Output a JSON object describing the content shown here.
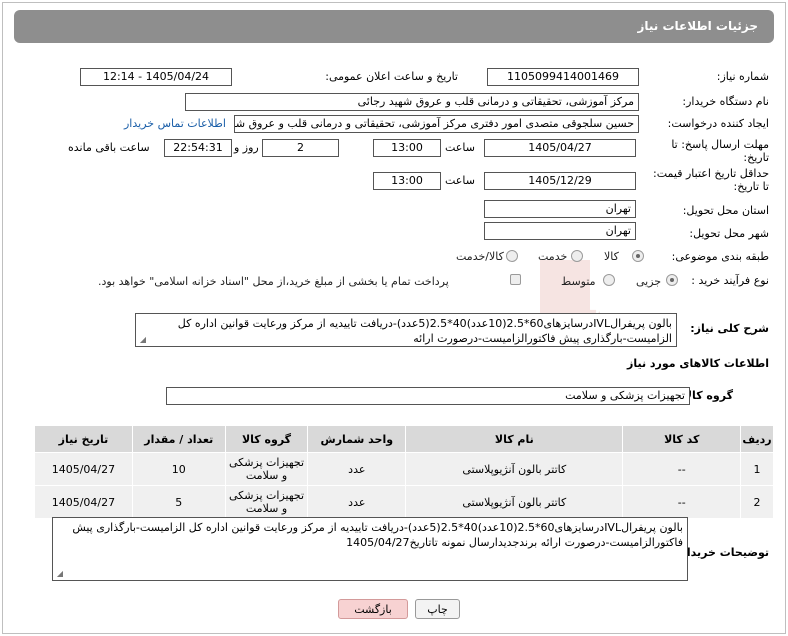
{
  "header": {
    "title": "جزئیات اطلاعات نیاز"
  },
  "fields": {
    "need_number_label": "شماره نیاز:",
    "need_number": "1105099414001469",
    "announce_label": "تاریخ و ساعت اعلان عمومی:",
    "announce_value": "1405/04/24 - 12:14",
    "buyer_org_label": "نام دستگاه خریدار:",
    "buyer_org": "مرکز آموزشی، تحقیقاتی و درمانی قلب و عروق شهید رجائی",
    "requester_label": "ایجاد کننده درخواست:",
    "requester": "حسین سلجوقی متصدی امور دفتری مرکز آموزشی، تحقیقاتی و درمانی قلب و عروق شهید رجائی",
    "contact_link": "اطلاعات تماس خریدار",
    "deadline_label_1": "مهلت ارسال پاسخ: تا",
    "deadline_label_2": "تاریخ:",
    "deadline_date": "1405/04/27",
    "time_label": "ساعت",
    "deadline_time": "13:00",
    "days_value": "2",
    "days_label": "روز و",
    "remaining_value": "22:54:31",
    "remaining_label": "ساعت باقی مانده",
    "validity_label_1": "حداقل تاریخ اعتبار قیمت:",
    "validity_label_2": "تا تاریخ:",
    "validity_date": "1405/12/29",
    "validity_time": "13:00",
    "province_label": "استان محل تحویل:",
    "province": "تهران",
    "city_label": "شهر محل تحویل:",
    "city": "تهران",
    "category_label": "طبقه بندی موضوعی:",
    "category_options": [
      "کالا",
      "خدمت",
      "کالا/خدمت"
    ],
    "process_label": "نوع فرآیند خرید :",
    "process_options": [
      "جزیی",
      "متوسط"
    ],
    "payment_note": "پرداخت تمام یا بخشی از مبلغ خرید،از محل \"اسناد خزانه اسلامی\" خواهد بود."
  },
  "summary": {
    "label": "شرح کلی نیاز:",
    "text": "بالون پریفرالIVLدرسایزهای60*2.5(10عدد)40*2.5(5عدد)-دریافت تاییدیه از مرکز ورعایت قوانین اداره کل الزامیست-بارگذاری پیش فاکتورالزامیست-درصورت ارائه"
  },
  "goods": {
    "section_title": "اطلاعات کالاهای مورد نیاز",
    "group_label": "گروه کالا:",
    "group_value": "تجهیزات پزشکی و سلامت",
    "columns": [
      "ردیف",
      "کد کالا",
      "نام کالا",
      "واحد شمارش",
      "گروه کالا",
      "تعداد / مقدار",
      "تاریخ نیاز"
    ],
    "rows": [
      {
        "row": "1",
        "code": "--",
        "name": "کاتتر بالون آنژیوپلاستی",
        "unit": "عدد",
        "group": "تجهیزات پزشکی و سلامت",
        "qty": "10",
        "date": "1405/04/27"
      },
      {
        "row": "2",
        "code": "--",
        "name": "کاتتر بالون آنژیوپلاستی",
        "unit": "عدد",
        "group": "تجهیزات پزشکی و سلامت",
        "qty": "5",
        "date": "1405/04/27"
      }
    ]
  },
  "buyer_notes": {
    "label": "توضیحات خریدار:",
    "text": "بالون پریفرالIVLدرسایزهای60*2.5(10عدد)40*2.5(5عدد)-دریافت تاییدیه از مرکز ورعایت قوانین اداره کل الزامیست-بارگذاری پیش فاکتورالزامیست-درصورت ارائه برندجدیدارسال نمونه تاتاریخ1405/04/27"
  },
  "buttons": {
    "print": "چاپ",
    "back": "بازگشت"
  },
  "watermark": "AriaTender.net",
  "colors": {
    "header_bg": "#8e8e8e",
    "link": "#1a5ea8",
    "back_button": "#f7d2d2",
    "table_header": "#d9d9d9"
  }
}
